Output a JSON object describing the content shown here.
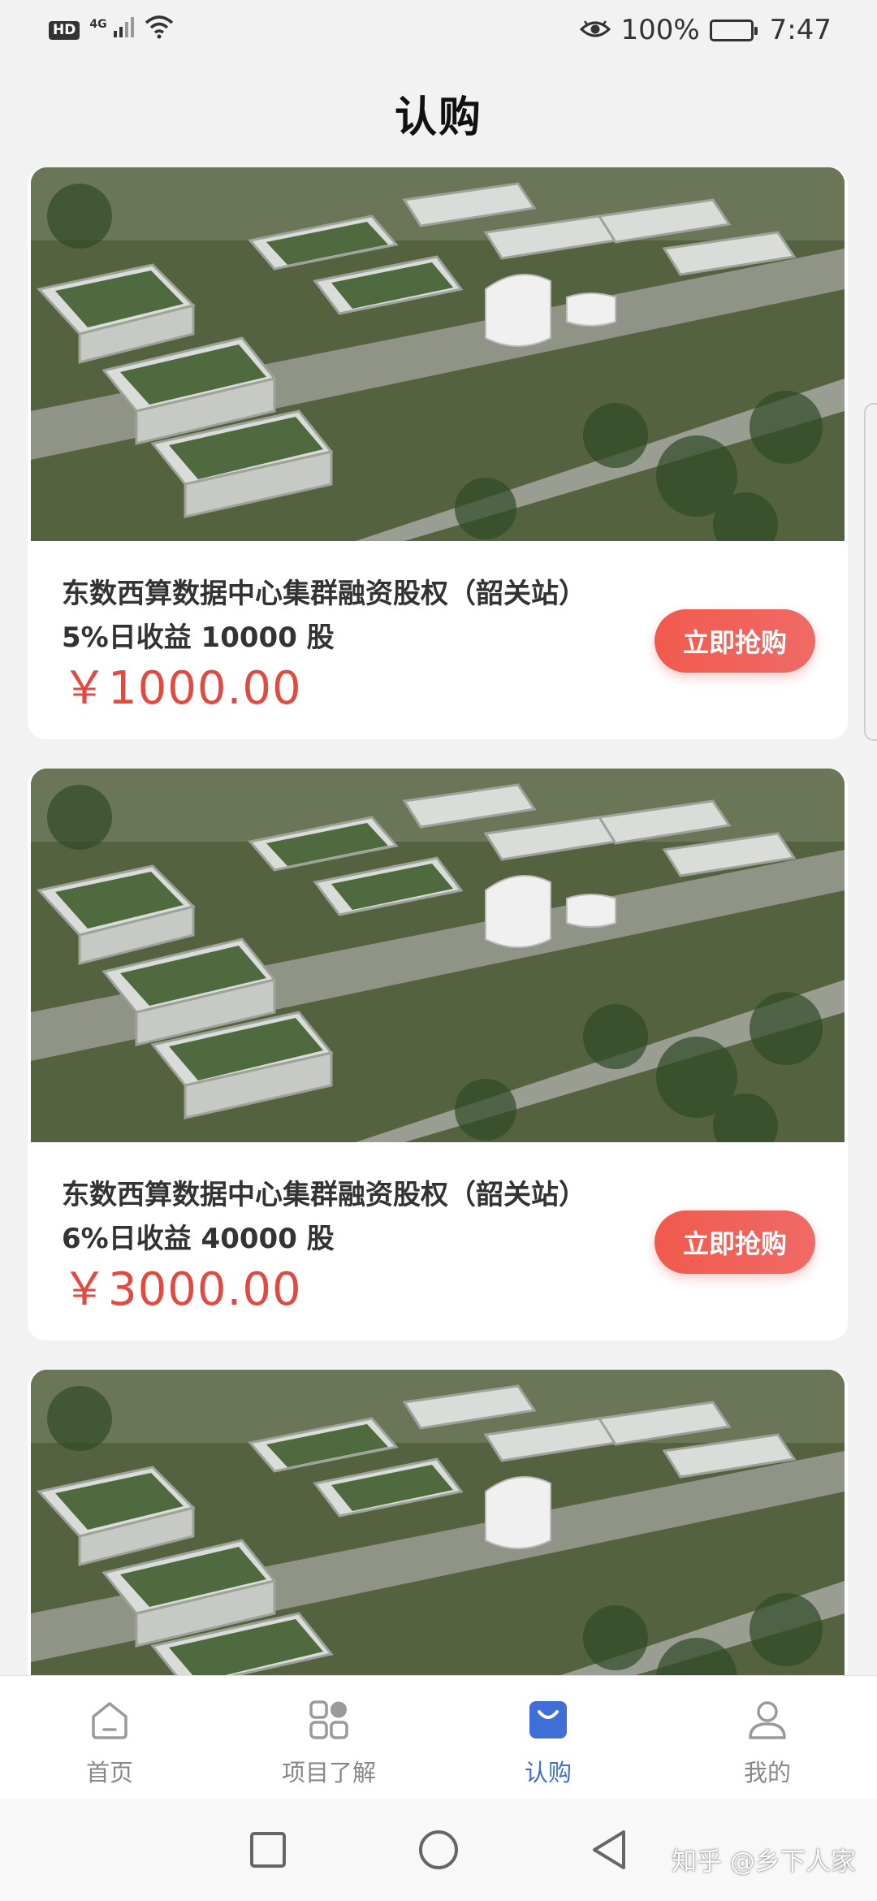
{
  "status_bar": {
    "hd": "HD",
    "network": "4G",
    "battery_text": "100%",
    "time": "7:47",
    "icons": [
      "signal-icon",
      "wifi-icon",
      "eye-comfort-icon",
      "battery-icon"
    ]
  },
  "header": {
    "title": "认购"
  },
  "products": [
    {
      "title": "东数西算数据中心集群融资股权（韶关站）",
      "subtitle": "5%日收益 10000 股",
      "price": "￥1000.00",
      "button": "立即抢购"
    },
    {
      "title": "东数西算数据中心集群融资股权（韶关站）",
      "subtitle": "6%日收益 40000 股",
      "price": "￥3000.00",
      "button": "立即抢购"
    }
  ],
  "tabs": [
    {
      "label": "首页",
      "icon": "home-icon",
      "active": false
    },
    {
      "label": "项目了解",
      "icon": "grid-icon",
      "active": false
    },
    {
      "label": "认购",
      "icon": "shopping-bag-icon",
      "active": true
    },
    {
      "label": "我的",
      "icon": "person-icon",
      "active": false
    }
  ],
  "colors": {
    "accent": "#3f6fd6",
    "price": "#e34a3f",
    "button": "#f15a4d",
    "background": "#f2f2f2"
  },
  "watermark": "知乎 @乡下人家"
}
